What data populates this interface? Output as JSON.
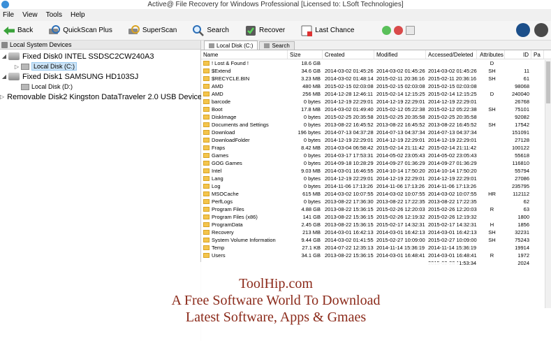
{
  "window": {
    "title": "Active@ File Recovery for Windows Professional [Licensed to: LSoft Technologies]"
  },
  "menu": [
    "File",
    "View",
    "Tools",
    "Help"
  ],
  "toolbar": {
    "back": "Back",
    "quickscan": "QuickScan Plus",
    "superscan": "SuperScan",
    "search": "Search",
    "recover": "Recover",
    "last_chance": "Last Chance"
  },
  "left_panel": {
    "header": "Local System Devices",
    "devices": [
      {
        "label": "Fixed Disk0 INTEL SSDSC2CW240A3",
        "volumes": [
          "Local Disk (C:)"
        ]
      },
      {
        "label": "Fixed Disk1 SAMSUNG HD103SJ",
        "volumes": [
          "Local Disk (D:)"
        ]
      },
      {
        "label": "Removable Disk2 Kingston DataTraveler 2.0 USB Device",
        "volumes": []
      }
    ]
  },
  "tabs": [
    "Local Disk (C:)",
    "Search"
  ],
  "columns": [
    "Name",
    "Size",
    "Created",
    "Modified",
    "Accessed/Deleted",
    "Attributes",
    "ID",
    "Pa"
  ],
  "files": [
    {
      "name": "! Lost & Found !",
      "size": "18.6 GB",
      "created": "",
      "modified": "",
      "accessed": "",
      "attr": "D",
      "id": ""
    },
    {
      "name": "$Extend",
      "size": "34.6 GB",
      "created": "2014-03-02 01:45:26",
      "modified": "2014-03-02 01:45:26",
      "accessed": "2014-03-02 01:45:26",
      "attr": "SH",
      "id": "11"
    },
    {
      "name": "$RECYCLE.BIN",
      "size": "3.23 MB",
      "created": "2014-03-02 01:48:14",
      "modified": "2015-02-11 20:36:16",
      "accessed": "2015-02-11 20:36:16",
      "attr": "SH",
      "id": "61"
    },
    {
      "name": "AMD",
      "size": "480 MB",
      "created": "2015-02-15 02:03:08",
      "modified": "2015-02-15 02:03:08",
      "accessed": "2015-02-15 02:03:08",
      "attr": "",
      "id": "98068"
    },
    {
      "name": "AMD",
      "size": "256 MB",
      "created": "2014-12-28 12:46:11",
      "modified": "2015-02-14 12:15:25",
      "accessed": "2015-02-14 12:15:25",
      "attr": "D",
      "id": "240040"
    },
    {
      "name": "barcode",
      "size": "0 bytes",
      "created": "2014-12-19 22:29:01",
      "modified": "2014-12-19 22:29:01",
      "accessed": "2014-12-19 22:29:01",
      "attr": "",
      "id": "26768"
    },
    {
      "name": "Boot",
      "size": "17.8 MB",
      "created": "2014-03-02 01:49:40",
      "modified": "2015-02-12 05:22:38",
      "accessed": "2015-02-12 05:22:38",
      "attr": "SH",
      "id": "75101"
    },
    {
      "name": "DiskImage",
      "size": "0 bytes",
      "created": "2015-02-25 20:35:58",
      "modified": "2015-02-25 20:35:58",
      "accessed": "2015-02-25 20:35:58",
      "attr": "",
      "id": "92082"
    },
    {
      "name": "Documents and Settings",
      "size": "0 bytes",
      "created": "2013-08-22 16:45:52",
      "modified": "2013-08-22 16:45:52",
      "accessed": "2013-08-22 16:45:52",
      "attr": "SH",
      "id": "17542"
    },
    {
      "name": "Download",
      "size": "196 bytes",
      "created": "2014-07-13 04:37:28",
      "modified": "2014-07-13 04:37:34",
      "accessed": "2014-07-13 04:37:34",
      "attr": "",
      "id": "151091"
    },
    {
      "name": "DownloadFolder",
      "size": "0 bytes",
      "created": "2014-12-19 22:29:01",
      "modified": "2014-12-19 22:29:01",
      "accessed": "2014-12-19 22:29:01",
      "attr": "",
      "id": "27128"
    },
    {
      "name": "Fraps",
      "size": "8.42 MB",
      "created": "2014-03-04 06:58:42",
      "modified": "2015-02-14 21:11:42",
      "accessed": "2015-02-14 21:11:42",
      "attr": "",
      "id": "100122"
    },
    {
      "name": "Games",
      "size": "0 bytes",
      "created": "2014-03-17 17:53:31",
      "modified": "2014-05-02 23:05:43",
      "accessed": "2014-05-02 23:05:43",
      "attr": "",
      "id": "55618"
    },
    {
      "name": "GOG Games",
      "size": "0 bytes",
      "created": "2014-09-18 10:28:29",
      "modified": "2014-09-27 01:36:29",
      "accessed": "2014-09-27 01:36:29",
      "attr": "",
      "id": "116810"
    },
    {
      "name": "Intel",
      "size": "9.03 MB",
      "created": "2014-03-01 16:46:55",
      "modified": "2014-10-14 17:50:20",
      "accessed": "2014-10-14 17:50:20",
      "attr": "",
      "id": "55794"
    },
    {
      "name": "Lang",
      "size": "0 bytes",
      "created": "2014-12-19 22:29:01",
      "modified": "2014-12-19 22:29:01",
      "accessed": "2014-12-19 22:29:01",
      "attr": "",
      "id": "27086"
    },
    {
      "name": "Log",
      "size": "0 bytes",
      "created": "2014-11-06 17:13:26",
      "modified": "2014-11-06 17:13:26",
      "accessed": "2014-11-06 17:13:26",
      "attr": "",
      "id": "235795"
    },
    {
      "name": "MSOCache",
      "size": "615 MB",
      "created": "2014-03-02 10:07:55",
      "modified": "2014-03-02 10:07:55",
      "accessed": "2014-03-02 10:07:55",
      "attr": "HR",
      "id": "112112"
    },
    {
      "name": "PerfLogs",
      "size": "0 bytes",
      "created": "2013-08-22 17:36:30",
      "modified": "2013-08-22 17:22:35",
      "accessed": "2013-08-22 17:22:35",
      "attr": "",
      "id": "62"
    },
    {
      "name": "Program Files",
      "size": "4.88 GB",
      "created": "2013-08-22 15:36:15",
      "modified": "2015-02-26 12:20:03",
      "accessed": "2015-02-26 12:20:03",
      "attr": "R",
      "id": "63"
    },
    {
      "name": "Program Files (x86)",
      "size": "141 GB",
      "created": "2013-08-22 15:36:15",
      "modified": "2015-02-26 12:19:32",
      "accessed": "2015-02-26 12:19:32",
      "attr": "",
      "id": "1800"
    },
    {
      "name": "ProgramData",
      "size": "2.45 GB",
      "created": "2013-08-22 15:36:15",
      "modified": "2015-02-17 14:32:31",
      "accessed": "2015-02-17 14:32:31",
      "attr": "H",
      "id": "1856"
    },
    {
      "name": "Recovery",
      "size": "213 MB",
      "created": "2014-03-01 16:42:13",
      "modified": "2014-03-01 16:42:13",
      "accessed": "2014-03-01 16:42:13",
      "attr": "SH",
      "id": "32231"
    },
    {
      "name": "System Volume Information",
      "size": "9.44 GB",
      "created": "2014-03-02 01:41:55",
      "modified": "2015-02-27 10:09:00",
      "accessed": "2015-02-27 10:09:00",
      "attr": "SH",
      "id": "75243"
    },
    {
      "name": "Temp",
      "size": "27.1 KB",
      "created": "2014-07-22 12:35:13",
      "modified": "2014-11-14 15:36:19",
      "accessed": "2014-11-14 15:36:19",
      "attr": "",
      "id": "19914"
    },
    {
      "name": "Users",
      "size": "34.1 GB",
      "created": "2013-08-22 15:36:15",
      "modified": "2014-03-01 16:48:41",
      "accessed": "2014-03-01 16:48:41",
      "attr": "R",
      "id": "1972"
    },
    {
      "name": "",
      "size": "",
      "created": "",
      "modified": "",
      "accessed": "2015-02-28 11:53:34",
      "attr": "",
      "id": "2024"
    }
  ],
  "watermark": {
    "line1": "ToolHip.com",
    "line2": "A Free Software World To Download",
    "line3": "Latest Software, Apps & Gmaes"
  },
  "colors": {
    "selection": "#cce4f7",
    "folder": "#f4c54d",
    "watermark_text": "#8b2a1a"
  }
}
